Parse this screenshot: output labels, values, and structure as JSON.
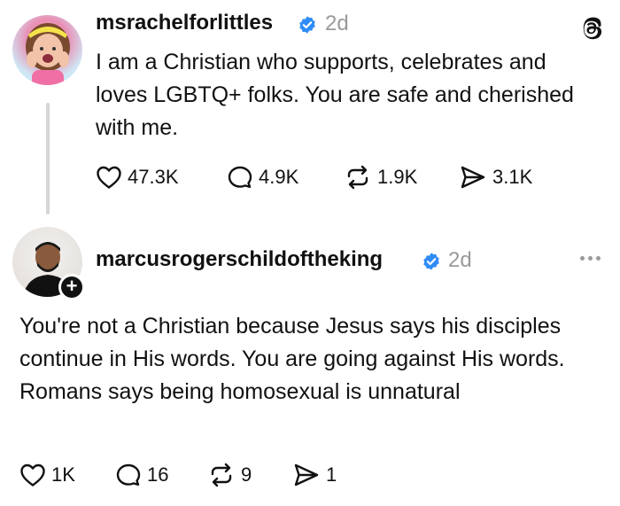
{
  "posts": [
    {
      "username": "msrachelforlittles",
      "time": "2d",
      "text": "I am a Christian who supports, celebrates and loves LGBTQ+ folks. You are safe and cherished with me.",
      "actions": {
        "likes": "47.3K",
        "replies": "4.9K",
        "reposts": "1.9K",
        "shares": "3.1K"
      }
    },
    {
      "username": "marcusrogerschildoftheking",
      "time": "2d",
      "text": "You're not a Christian because Jesus says his disciples continue in His words. You are going against His words. Romans says being homosexual is unnatural",
      "actions": {
        "likes": "1K",
        "replies": "16",
        "reposts": "9",
        "shares": "1"
      }
    }
  ],
  "icons": {
    "verified": "verified-badge-icon",
    "threads": "threads-logo-icon",
    "like": "heart-icon",
    "reply": "comment-icon",
    "repost": "repost-icon",
    "share": "send-icon",
    "follow": "plus-icon",
    "more": "more-options-icon"
  },
  "colors": {
    "verified": "#2f8cf7",
    "muted": "#9a9a9a",
    "text": "#111111"
  }
}
